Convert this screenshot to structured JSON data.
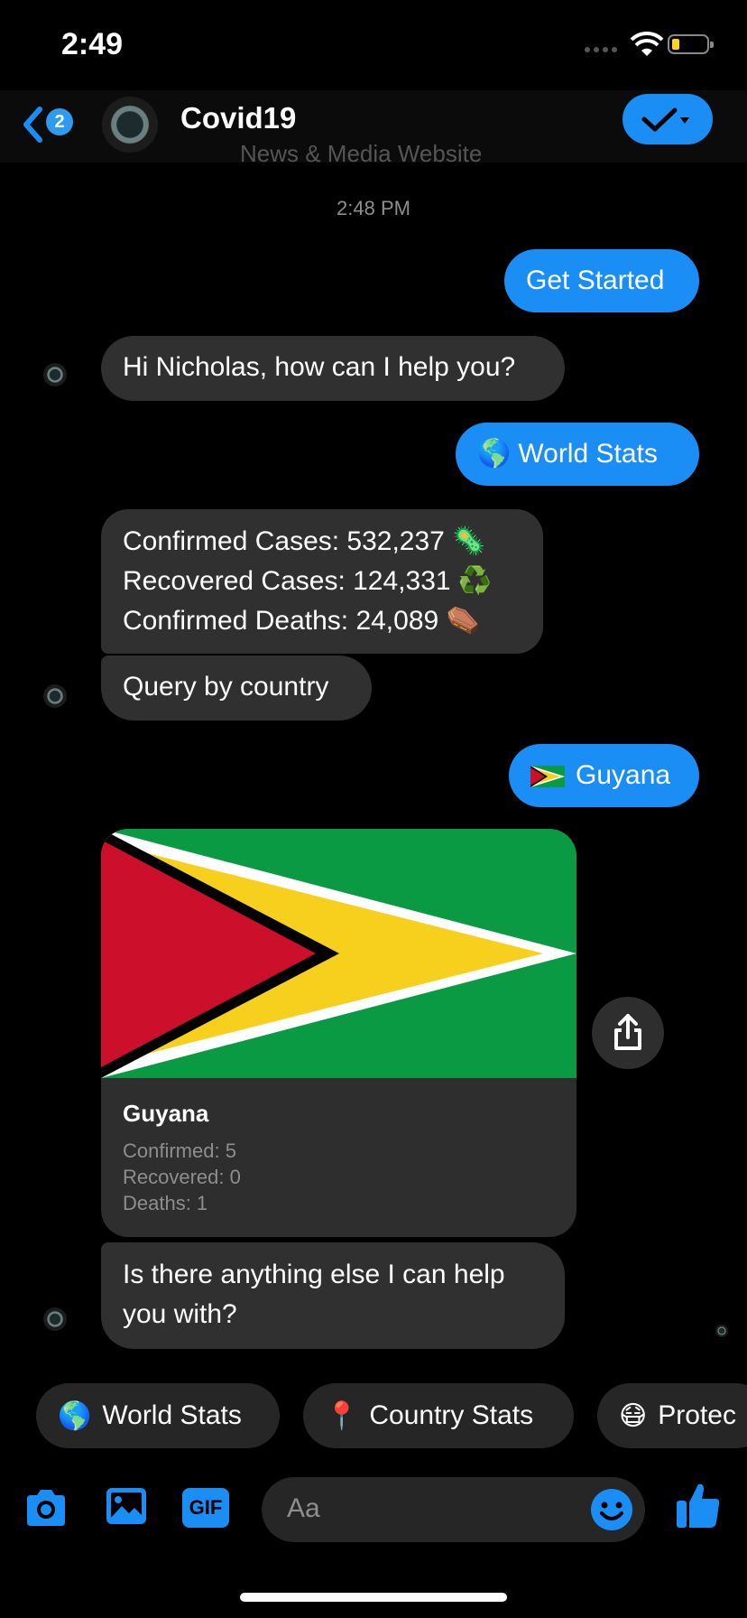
{
  "status": {
    "time": "2:49"
  },
  "header": {
    "back_badge": "2",
    "title": "Covid19"
  },
  "chat": {
    "faded_text": "News & Media Website",
    "timestamp": "2:48 PM",
    "messages": [
      {
        "text": "Get Started"
      },
      {
        "text": "Hi Nicholas, how can I help you?"
      },
      {
        "icon": "🌎",
        "text": "World Stats"
      },
      {
        "lines": [
          "Confirmed Cases: 532,237",
          "Recovered Cases: 124,331",
          "Confirmed Deaths: 24,089"
        ],
        "emojis": [
          "🦠",
          "♻️",
          "⚰️"
        ]
      },
      {
        "text": "Query by country"
      },
      {
        "text": "Guyana"
      },
      {
        "text": "Is there anything else I can help you with?"
      }
    ],
    "card": {
      "name": "Guyana",
      "confirmed": "Confirmed: 5",
      "recovered": "Recovered: 0",
      "deaths": "Deaths: 1",
      "flag_colors": {
        "green": "#0a9a44",
        "white": "#ffffff",
        "yellow": "#f7cf1d",
        "black": "#000000",
        "red": "#cc0f2b"
      }
    }
  },
  "quick_replies": [
    {
      "icon": "🌎",
      "label": "World Stats"
    },
    {
      "icon": "📍",
      "label": "Country Stats"
    },
    {
      "icon": "😷",
      "label": "Protec"
    }
  ],
  "composer": {
    "placeholder": "Aa",
    "gif_label": "GIF"
  },
  "colors": {
    "accent": "#1a8ef5",
    "bubble_in": "#303030",
    "background": "#000000"
  }
}
